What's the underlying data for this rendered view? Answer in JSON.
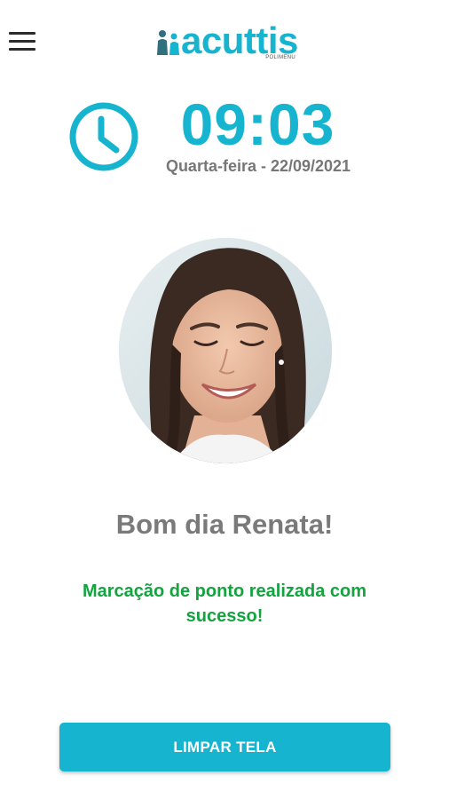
{
  "header": {
    "menu_icon": "hamburger-menu-icon",
    "logo_text": "acuttis",
    "logo_subtext": "POLIMENU"
  },
  "clock": {
    "icon": "clock-icon",
    "time": "09:03",
    "date": "Quarta-feira - 22/09/2021"
  },
  "user": {
    "avatar": "user-photo",
    "greeting": "Bom dia Renata!"
  },
  "status": {
    "message": "Marcação de ponto realizada com sucesso!",
    "color": "#13a33f"
  },
  "actions": {
    "clear_label": "LIMPAR TELA"
  },
  "colors": {
    "accent": "#17b4cf",
    "muted_text": "#777777"
  }
}
